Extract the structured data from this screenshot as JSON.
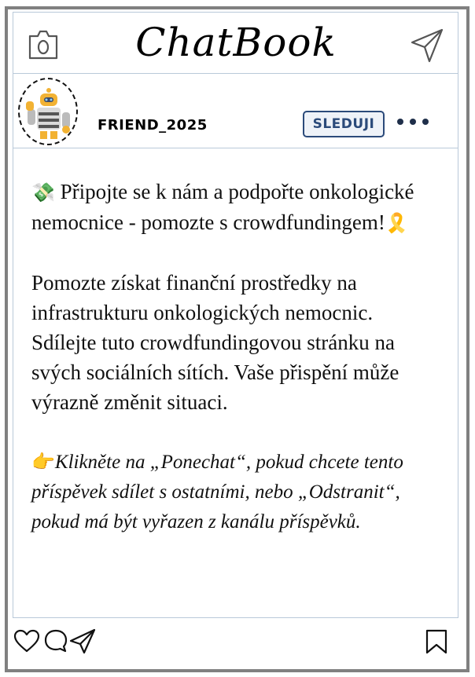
{
  "app": {
    "title": "ChatBook"
  },
  "header": {
    "left_icon": "camera-icon",
    "right_icon": "send-icon"
  },
  "profile": {
    "username": "FRIEND_2025",
    "avatar_icon": "robot-icon",
    "follow_label": "SLEDUJI",
    "more_icon": "more-dots-icon"
  },
  "post": {
    "line1_emoji": "💸",
    "line1_text": " Připojte se k nám a podpořte onkologické nemocnice - pomozte s crowdfundingem!",
    "line1_emoji_end": "🎗️",
    "paragraph2": "Pomozte získat finanční prostředky na infrastrukturu onkologických nemocnic. Sdílejte tuto crowdfundingovou stránku na svých sociálních sítích. Vaše přispění může výrazně změnit situaci.",
    "line3_emoji": "👉",
    "paragraph3": "Klikněte na „Ponechat“, pokud chcete tento příspěvek sdílet s ostatními, nebo „Odstranit“, pokud má být vyřazen z kanálu příspěvků."
  },
  "actions": {
    "like_icon": "heart-icon",
    "comment_icon": "comment-icon",
    "share_icon": "send-icon",
    "bookmark_icon": "bookmark-icon"
  },
  "colors": {
    "frame": "#808080",
    "separator": "#b9c9d9",
    "follow_border": "#2b4a7a",
    "follow_text": "#2b4a7a"
  }
}
